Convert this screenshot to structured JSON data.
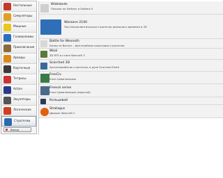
{
  "sidebar": {
    "items": [
      {
        "label": "Настольные",
        "icon": "board-games-icon",
        "color": "#c0392b"
      },
      {
        "label": "Симуляторы",
        "icon": "simulators-icon",
        "color": "#e0a020"
      },
      {
        "label": "Мощные",
        "icon": "smiley-icon",
        "color": "#e8c820"
      },
      {
        "label": "Головоломки",
        "icon": "puzzle-icon",
        "color": "#2b6fc0"
      },
      {
        "label": "Приключения",
        "icon": "adventure-icon",
        "color": "#8a6a3a"
      },
      {
        "label": "Аркады",
        "icon": "arcade-icon",
        "color": "#d98a1a"
      },
      {
        "label": "Карточные",
        "icon": "cards-icon",
        "color": "#3a3a3a"
      },
      {
        "label": "Тетрисы",
        "icon": "tetris-icon",
        "color": "#cc3333"
      },
      {
        "label": "Action",
        "icon": "action-icon",
        "color": "#2a3a8a"
      },
      {
        "label": "Эмуляторы",
        "icon": "emulators-icon",
        "color": "#555555"
      },
      {
        "label": "Логические",
        "icon": "logic-icon",
        "color": "#d04020"
      },
      {
        "label": "Стратегии",
        "icon": "strategy-icon",
        "color": "#2a6ab0"
      }
    ],
    "active_index": 11,
    "quit_label": "Выход"
  },
  "games": [
    {
      "title": "Widelands",
      "desc": "Похожа на Settlers и Settlers II",
      "thumb": "widelands-icon",
      "color": "#cfcfcf"
    },
    {
      "title": "Warzone 2100",
      "desc": "Постапокалиптическая стратегия реального времени в 3D",
      "thumb": "warzone2100-logo",
      "color": "#2e6fb8"
    },
    {
      "title": "Battle for Wesnoth",
      "desc": "Битва за Веснот - фэнтезийная пошаговая стратегия",
      "thumb": "wesnoth-icon",
      "color": "#d8d8d8"
    },
    {
      "title": "Weal",
      "desc": "3D RTS в стиле Warcraft 3",
      "thumb": "weal-icon",
      "color": "#5a7a3a"
    },
    {
      "title": "Scorched 3D",
      "desc": "Артиллерийская стратегия, в духе Scorched Earth",
      "thumb": "scorched3d-icon",
      "color": "#3a6a9a"
    },
    {
      "title": "FreeCiv",
      "desc": "Клон Цивилизации",
      "thumb": "freeciv-icon",
      "color": "#3a7a4a"
    },
    {
      "title": "Freecol series",
      "desc": "Клон Цивилизации (морской)",
      "thumb": "freecol-icon",
      "color": "#4a6a8a"
    },
    {
      "title": "Кольцевой",
      "desc": "",
      "thumb": "ring-icon",
      "color": "#2a3a5a"
    },
    {
      "title": "Stratagus",
      "desc": "Движок Warcraft 2",
      "thumb": "stratagus-icon",
      "color": "#e06010"
    }
  ],
  "colors": {
    "accent": "#2e6fb8",
    "highlight_row": "#f2f2f2"
  }
}
